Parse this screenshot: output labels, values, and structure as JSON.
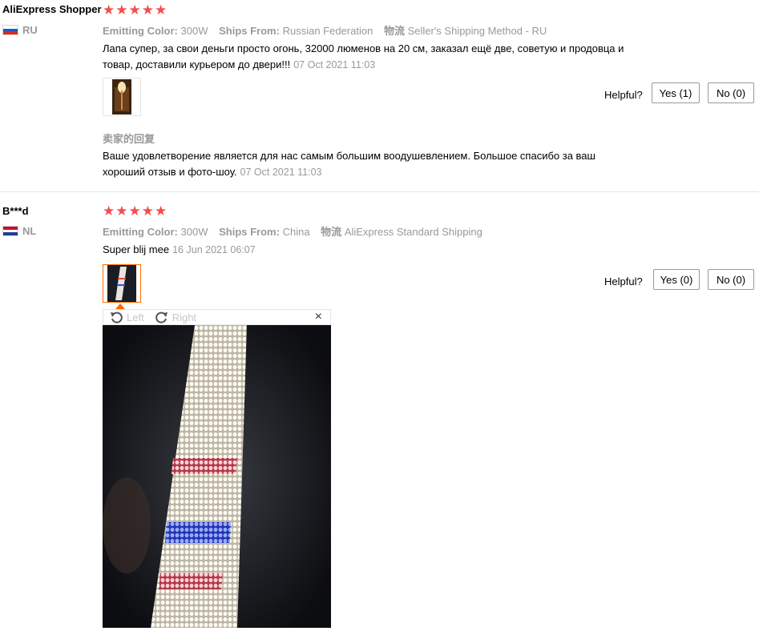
{
  "review1": {
    "user": "AliExpress Shopper",
    "country": "RU",
    "stars": 5,
    "attrs": [
      {
        "key": "Emitting Color:",
        "value": "300W"
      },
      {
        "key": "Ships From:",
        "value": "Russian Federation"
      },
      {
        "key": "物流",
        "value": "Seller's Shipping Method - RU"
      }
    ],
    "text": "Лапа супер, за свои деньги просто огонь, 32000 люменов на 20 см, заказал ещё две, советую и продовца и товар, доставили курьером до двери!!!",
    "date": "07 Oct 2021 11:03",
    "helpful_label": "Helpful?",
    "yes_label": "Yes (1)",
    "no_label": "No (0)",
    "seller_heading": "卖家的回复",
    "seller_text": "Ваше удовлетворение является для нас самым большим воодушевлением. Большое спасибо за ваш хороший отзыв и фото-шоу.",
    "seller_date": "07 Oct 2021 11:03"
  },
  "review2": {
    "user": "B***d",
    "country": "NL",
    "stars": 5,
    "attrs": [
      {
        "key": "Emitting Color:",
        "value": "300W"
      },
      {
        "key": "Ships From:",
        "value": "China"
      },
      {
        "key": "物流",
        "value": "AliExpress Standard Shipping"
      }
    ],
    "text": "Super blij mee",
    "date": "16 Jun 2021 06:07",
    "helpful_label": "Helpful?",
    "yes_label": "Yes (0)",
    "no_label": "No (0)"
  },
  "viewer": {
    "rotate_left": "Left",
    "rotate_right": "Right",
    "close": "×"
  },
  "colors": {
    "star": "#f44d4d",
    "accent": "#ff6a00",
    "muted": "#999999"
  }
}
